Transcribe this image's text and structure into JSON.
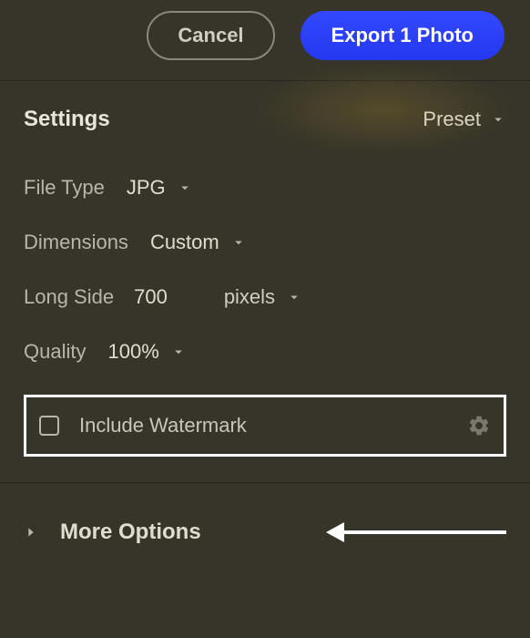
{
  "buttons": {
    "cancel": "Cancel",
    "export": "Export 1 Photo"
  },
  "settings": {
    "title": "Settings",
    "preset_label": "Preset",
    "file_type": {
      "label": "File Type",
      "value": "JPG"
    },
    "dimensions": {
      "label": "Dimensions",
      "value": "Custom"
    },
    "long_side": {
      "label": "Long Side",
      "value": "700",
      "units": "pixels"
    },
    "quality": {
      "label": "Quality",
      "value": "100%"
    },
    "watermark": {
      "label": "Include Watermark",
      "checked": false
    }
  },
  "more_options": {
    "label": "More Options"
  }
}
